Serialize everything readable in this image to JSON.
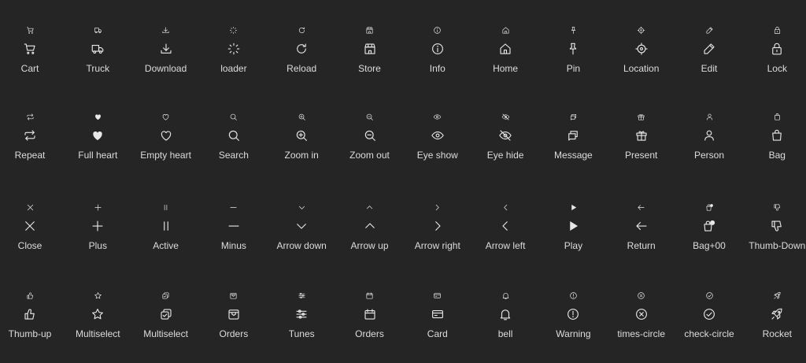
{
  "rows": [
    [
      {
        "label": "Cart",
        "icon": "cart-icon"
      },
      {
        "label": "Truck",
        "icon": "truck-icon"
      },
      {
        "label": "Download",
        "icon": "download-icon"
      },
      {
        "label": "loader",
        "icon": "loader-icon"
      },
      {
        "label": "Reload",
        "icon": "reload-icon"
      },
      {
        "label": "Store",
        "icon": "store-icon"
      },
      {
        "label": "Info",
        "icon": "info-icon"
      },
      {
        "label": "Home",
        "icon": "home-icon"
      },
      {
        "label": "Pin",
        "icon": "pin-icon"
      },
      {
        "label": "Location",
        "icon": "location-icon"
      },
      {
        "label": "Edit",
        "icon": "edit-icon"
      },
      {
        "label": "Lock",
        "icon": "lock-icon"
      }
    ],
    [
      {
        "label": "Repeat",
        "icon": "repeat-icon"
      },
      {
        "label": "Full heart",
        "icon": "heart-full-icon"
      },
      {
        "label": "Empty heart",
        "icon": "heart-empty-icon"
      },
      {
        "label": "Search",
        "icon": "search-icon"
      },
      {
        "label": "Zoom in",
        "icon": "zoom-in-icon"
      },
      {
        "label": "Zoom out",
        "icon": "zoom-out-icon"
      },
      {
        "label": "Eye show",
        "icon": "eye-show-icon"
      },
      {
        "label": "Eye hide",
        "icon": "eye-hide-icon"
      },
      {
        "label": "Message",
        "icon": "message-icon"
      },
      {
        "label": "Present",
        "icon": "present-icon"
      },
      {
        "label": "Person",
        "icon": "person-icon"
      },
      {
        "label": "Bag",
        "icon": "bag-icon"
      }
    ],
    [
      {
        "label": "Close",
        "icon": "close-icon"
      },
      {
        "label": "Plus",
        "icon": "plus-icon"
      },
      {
        "label": "Active",
        "icon": "pause-icon"
      },
      {
        "label": "Minus",
        "icon": "minus-icon"
      },
      {
        "label": "Arrow down",
        "icon": "chevron-down-icon"
      },
      {
        "label": "Arrow up",
        "icon": "chevron-up-icon"
      },
      {
        "label": "Arrow right",
        "icon": "chevron-right-icon"
      },
      {
        "label": "Arrow left",
        "icon": "chevron-left-icon"
      },
      {
        "label": "Play",
        "icon": "play-icon"
      },
      {
        "label": "Return",
        "icon": "arrow-left-icon"
      },
      {
        "label": "Bag+00",
        "icon": "bag-badge-icon"
      },
      {
        "label": "Thumb-Down",
        "icon": "thumb-down-icon"
      }
    ],
    [
      {
        "label": "Thumb-up",
        "icon": "thumb-up-icon"
      },
      {
        "label": "Multiselect",
        "icon": "star-icon"
      },
      {
        "label": "Multiselect",
        "icon": "multiselect-icon"
      },
      {
        "label": "Orders",
        "icon": "orders-box-icon"
      },
      {
        "label": "Tunes",
        "icon": "tunes-icon"
      },
      {
        "label": "Orders",
        "icon": "calendar-icon"
      },
      {
        "label": "Card",
        "icon": "card-icon"
      },
      {
        "label": "bell",
        "icon": "bell-icon"
      },
      {
        "label": "Warning",
        "icon": "warning-icon"
      },
      {
        "label": "times-circle",
        "icon": "times-circle-icon"
      },
      {
        "label": "check-circle",
        "icon": "check-circle-icon"
      },
      {
        "label": "Rocket",
        "icon": "rocket-icon"
      }
    ]
  ]
}
